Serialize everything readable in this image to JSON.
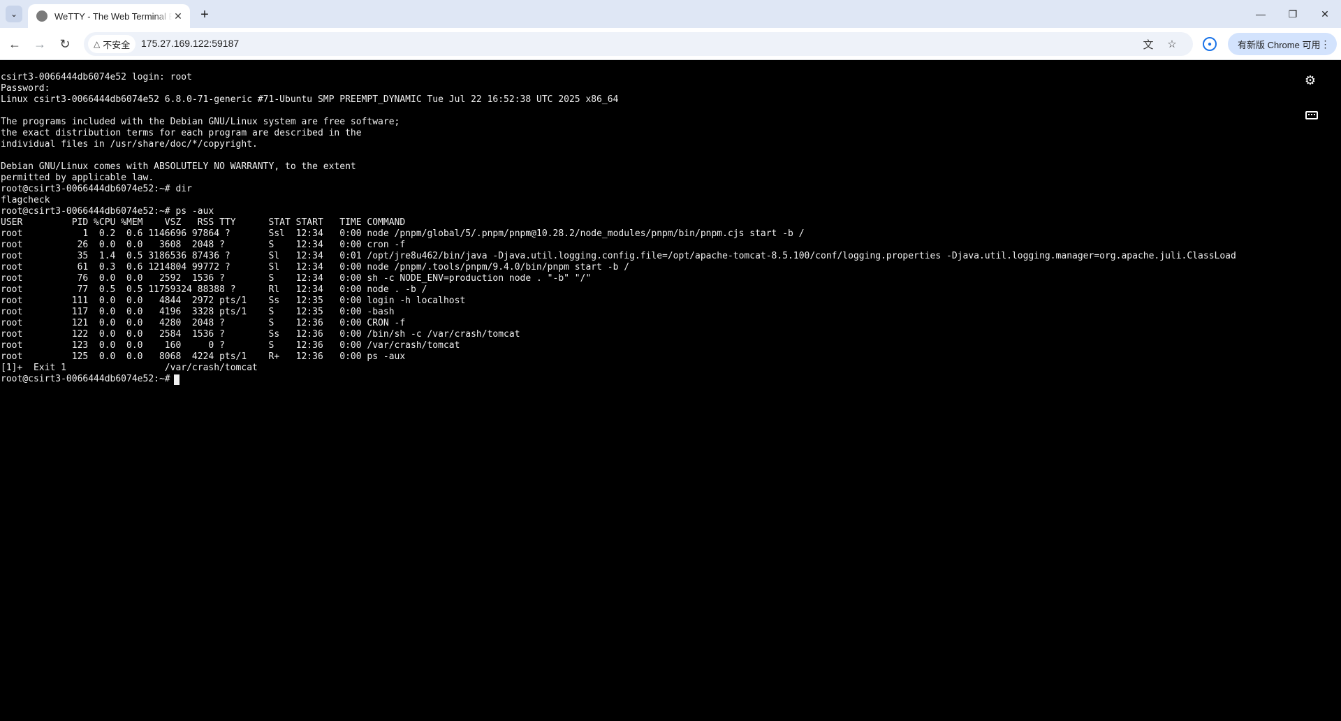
{
  "browser": {
    "tab_title": "WeTTY - The Web Terminal Emulator",
    "new_tab_label": "+",
    "security_label": "不安全",
    "url": "175.27.169.122:59187",
    "update_button_label": "有新版 Chrome 可用"
  },
  "icons": {
    "tab_dropdown": "chevron-down-icon",
    "tab_close": "close-icon",
    "back": "arrow-left-icon",
    "forward": "arrow-right-icon",
    "reload": "reload-icon",
    "warning": "warning-icon",
    "translate": "translate-icon",
    "bookmark": "star-icon",
    "profile": "profile-icon",
    "menu": "kebab-menu-icon",
    "terminal_settings": "gears-icon",
    "terminal_keyboard": "keyboard-icon"
  },
  "terminal": {
    "output": "csirt3-0066444db6074e52 login: root\nPassword:\nLinux csirt3-0066444db6074e52 6.8.0-71-generic #71-Ubuntu SMP PREEMPT_DYNAMIC Tue Jul 22 16:52:38 UTC 2025 x86_64\n\nThe programs included with the Debian GNU/Linux system are free software;\nthe exact distribution terms for each program are described in the\nindividual files in /usr/share/doc/*/copyright.\n\nDebian GNU/Linux comes with ABSOLUTELY NO WARRANTY, to the extent\npermitted by applicable law.\nroot@csirt3-0066444db6074e52:~# dir\nflagcheck\nroot@csirt3-0066444db6074e52:~# ps -aux\nUSER         PID %CPU %MEM    VSZ   RSS TTY      STAT START   TIME COMMAND\nroot           1  0.2  0.6 1146696 97864 ?       Ssl  12:34   0:00 node /pnpm/global/5/.pnpm/pnpm@10.28.2/node_modules/pnpm/bin/pnpm.cjs start -b /\nroot          26  0.0  0.0   3608  2048 ?        S    12:34   0:00 cron -f\nroot          35  1.4  0.5 3186536 87436 ?       Sl   12:34   0:01 /opt/jre8u462/bin/java -Djava.util.logging.config.file=/opt/apache-tomcat-8.5.100/conf/logging.properties -Djava.util.logging.manager=org.apache.juli.ClassLoad\nroot          61  0.3  0.6 1214804 99772 ?       Sl   12:34   0:00 node /pnpm/.tools/pnpm/9.4.0/bin/pnpm start -b /\nroot          76  0.0  0.0   2592  1536 ?        S    12:34   0:00 sh -c NODE_ENV=production node . \"-b\" \"/\"\nroot          77  0.5  0.5 11759324 88388 ?      Rl   12:34   0:00 node . -b /\nroot         111  0.0  0.0   4844  2972 pts/1    Ss   12:35   0:00 login -h localhost\nroot         117  0.0  0.0   4196  3328 pts/1    S    12:35   0:00 -bash\nroot         121  0.0  0.0   4280  2048 ?        S    12:36   0:00 CRON -f\nroot         122  0.0  0.0   2584  1536 ?        Ss   12:36   0:00 /bin/sh -c /var/crash/tomcat\nroot         123  0.0  0.0    160     0 ?        S    12:36   0:00 /var/crash/tomcat\nroot         125  0.0  0.0   8068  4224 pts/1    R+   12:36   0:00 ps -aux\n[1]+  Exit 1                  /var/crash/tomcat",
    "prompt": "root@csirt3-0066444db6074e52:~#"
  }
}
